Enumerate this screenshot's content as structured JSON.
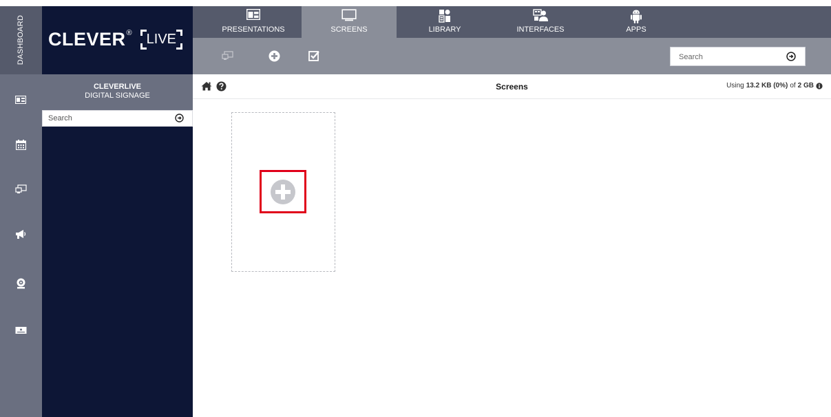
{
  "brand": {
    "name": "CLEVER",
    "reg": "®",
    "live": "LIVE"
  },
  "rail": {
    "dashboard_label": "DASHBOARD",
    "items": [
      {
        "icon": "presentation-icon"
      },
      {
        "icon": "calendar-icon"
      },
      {
        "icon": "screens-icon"
      },
      {
        "icon": "megaphone-icon"
      },
      {
        "icon": "webcam-icon"
      },
      {
        "icon": "display-device-icon"
      }
    ]
  },
  "sidebar": {
    "title_line1": "CLEVERLIVE",
    "title_line2": "DIGITAL SIGNAGE",
    "search_placeholder": "Search"
  },
  "tabs": [
    {
      "label": "PRESENTATIONS",
      "icon": "presentation-icon",
      "active": false
    },
    {
      "label": "SCREENS",
      "icon": "monitor-icon",
      "active": true
    },
    {
      "label": "LIBRARY",
      "icon": "library-icon",
      "active": false
    },
    {
      "label": "INTERFACES",
      "icon": "interfaces-icon",
      "active": false
    },
    {
      "label": "APPS",
      "icon": "android-icon",
      "active": false
    }
  ],
  "toolbar": {
    "search_placeholder": "Search"
  },
  "header": {
    "title": "Screens",
    "usage_prefix": "Using",
    "usage_used": "13.2 KB (0%)",
    "usage_mid": "of",
    "usage_total": "2 GB"
  },
  "colors": {
    "rail": "#6a6f80",
    "topbar": "#555a6b",
    "active_tab": "#8a8e99",
    "navy": "#0d1636",
    "highlight": "#e0001a"
  }
}
